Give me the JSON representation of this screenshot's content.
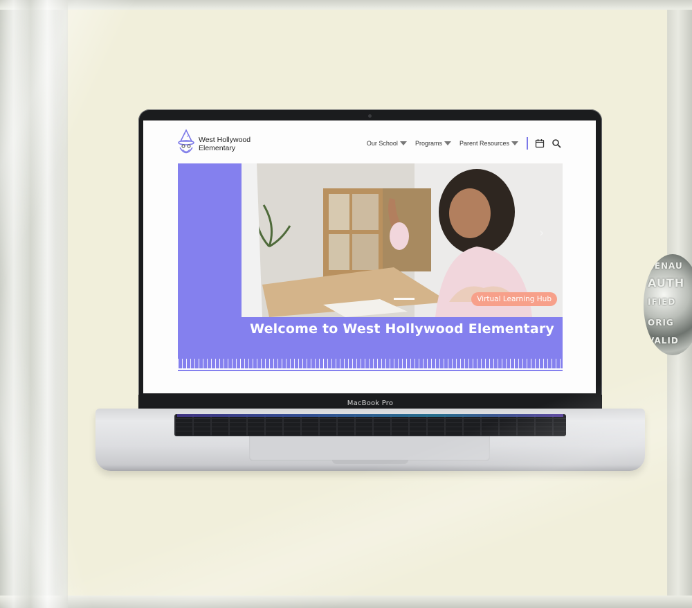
{
  "device": {
    "label": "MacBook Pro"
  },
  "sticker": {
    "lines": [
      "CENAU",
      "AUTH",
      "IFIED",
      "ORIG",
      "VALID"
    ]
  },
  "site": {
    "logo": {
      "line1": "West Hollywood",
      "line2": "Elementary"
    },
    "nav": [
      {
        "label": "Our School",
        "has_dropdown": true
      },
      {
        "label": "Programs",
        "has_dropdown": true
      },
      {
        "label": "Parent Resources",
        "has_dropdown": true
      }
    ],
    "icons": [
      "calendar-icon",
      "search-icon"
    ],
    "hero": {
      "badge": "Virtual Learning Hub",
      "title": "Welcome to West Hollywood Elementary",
      "prev_arrow": "‹",
      "next_arrow": "›"
    }
  },
  "colors": {
    "accent": "#8480ee",
    "badge": "#f7a08a",
    "background": "#f1efdb"
  }
}
